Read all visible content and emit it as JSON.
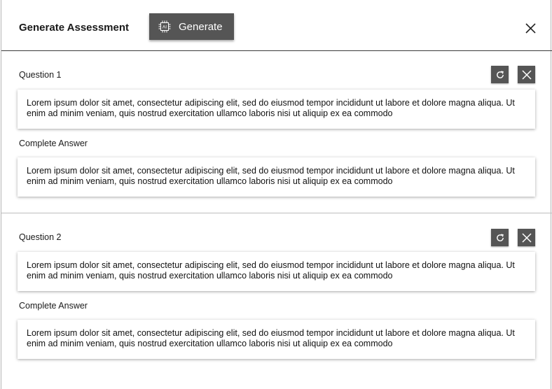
{
  "modal": {
    "title": "Generate Assessment",
    "generate_label": "Generate",
    "generate_icon": "ai-chip-icon",
    "close_icon": "close-icon"
  },
  "questions": [
    {
      "label": "Question 1",
      "question_text": "Lorem ipsum dolor sit amet, consectetur adipiscing elit, sed do eiusmod tempor incididunt ut labore et dolore magna aliqua. Ut enim ad minim veniam, quis nostrud exercitation ullamco laboris nisi ut aliquip ex ea commodo",
      "answer_label": "Complete Answer",
      "answer_text": "Lorem ipsum dolor sit amet, consectetur adipiscing elit, sed do eiusmod tempor incididunt ut labore et dolore magna aliqua. Ut enim ad minim veniam, quis nostrud exercitation ullamco laboris nisi ut aliquip ex ea commodo"
    },
    {
      "label": "Question 2",
      "question_text": "Lorem ipsum dolor sit amet, consectetur adipiscing elit, sed do eiusmod tempor incididunt ut labore et dolore magna aliqua. Ut enim ad minim veniam, quis nostrud exercitation ullamco laboris nisi ut aliquip ex ea commodo",
      "answer_label": "Complete Answer",
      "answer_text": "Lorem ipsum dolor sit amet, consectetur adipiscing elit, sed do eiusmod tempor incididunt ut labore et dolore magna aliqua. Ut enim ad minim veniam, quis nostrud exercitation ullamco laboris nisi ut aliquip ex ea commodo"
    }
  ],
  "icons": {
    "regenerate": "refresh-icon",
    "remove": "close-icon"
  },
  "colors": {
    "button_bg": "#555555",
    "button_fg": "#ffffff"
  }
}
